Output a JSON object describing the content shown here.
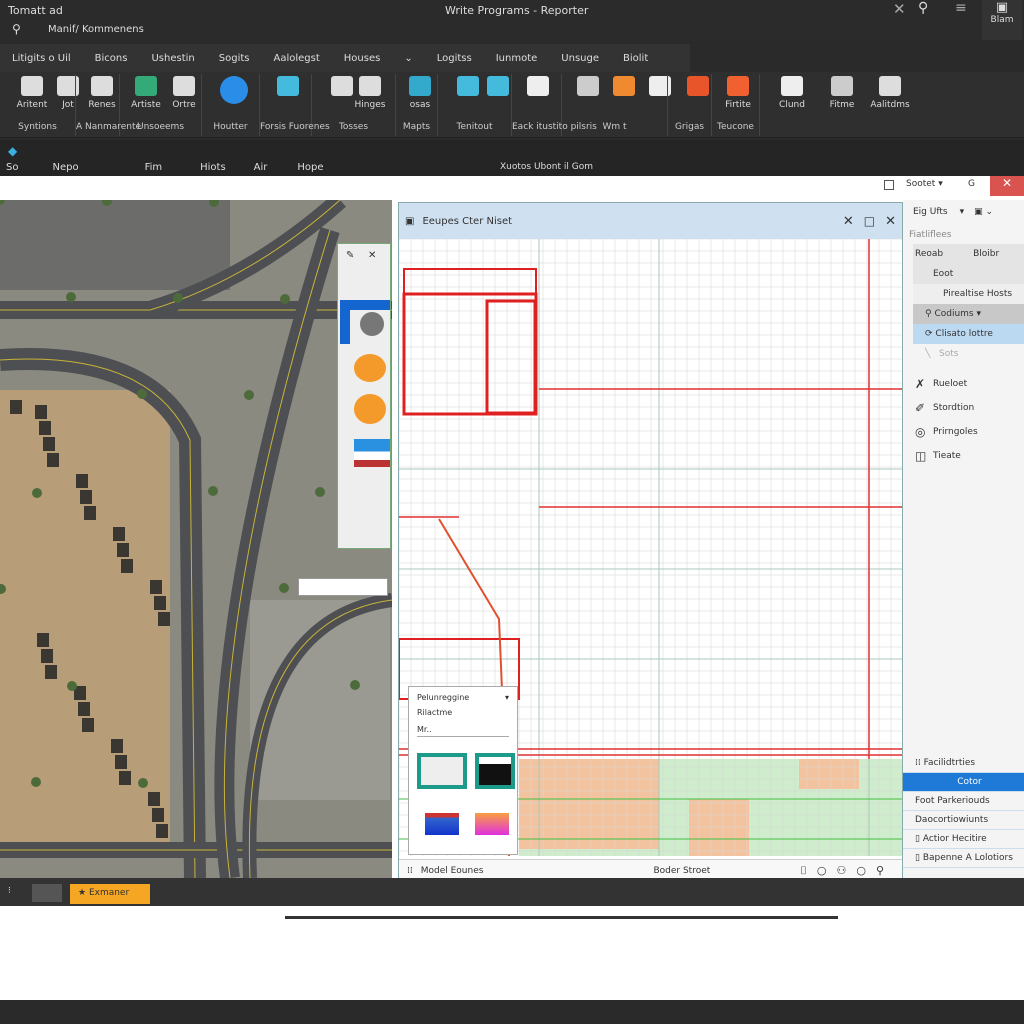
{
  "window": {
    "left_title": "Tomatt ad",
    "center_title": "Write Programs - Reporter",
    "subtitle": "Manif/ Kommenens",
    "blam_label": "Blam"
  },
  "menu": [
    "Litigits o Uil",
    "Bicons",
    "Ushestin",
    "Sogits",
    "Aalolegst",
    "Houses",
    "Logitss",
    "Iunmote",
    "Unsuge",
    "Biolit"
  ],
  "ribbon": {
    "buttons": [
      {
        "label": "Aritent",
        "icon": "map-layer-icon",
        "color": "#ddd"
      },
      {
        "label": "Jot",
        "icon": "pen-icon",
        "color": "#ddd"
      },
      {
        "label": "Renes",
        "icon": "table-icon",
        "color": "#ddd"
      },
      {
        "label": "Artiste",
        "icon": "globe-icon",
        "color": "#3a7"
      },
      {
        "label": "Ortre",
        "icon": "bucket-icon",
        "color": "#ddd"
      },
      {
        "label": "",
        "icon": "record-icon",
        "color": "#2a8ee8"
      },
      {
        "label": "",
        "icon": "printer-icon",
        "color": "#4bd"
      },
      {
        "label": "",
        "icon": "line-icon",
        "color": "#ddd"
      },
      {
        "label": "Hinges",
        "icon": "image-icon",
        "color": "#ddd"
      },
      {
        "label": "osas",
        "icon": "info-icon",
        "color": "#3ac"
      },
      {
        "label": "",
        "icon": "hook-icon",
        "color": "#4bd"
      },
      {
        "label": "",
        "icon": "printer-icon",
        "color": "#4bd"
      },
      {
        "label": "",
        "icon": "document-icon",
        "color": "#eee"
      },
      {
        "label": "",
        "icon": "face-icon",
        "color": "#ccc"
      },
      {
        "label": "",
        "icon": "swirl-icon",
        "color": "#f08a30"
      },
      {
        "label": "",
        "icon": "brush-icon",
        "color": "#eee"
      },
      {
        "label": "",
        "icon": "shape-icon",
        "color": "#e8552a"
      },
      {
        "label": "Firtite",
        "icon": "fire-icon",
        "color": "#f06030"
      },
      {
        "label": "Clund",
        "icon": "cloud-icon",
        "color": "#eee"
      },
      {
        "label": "Fitme",
        "icon": "list-icon",
        "color": "#ccc"
      },
      {
        "label": "Aalitdms",
        "icon": "frame-icon",
        "color": "#ddd"
      }
    ],
    "groups": [
      "Syntions",
      "A Nanmarente",
      "Unsoeems",
      "Houtter",
      "Forsis Fuorenes",
      "Tosses",
      "Mapts",
      "Tenitout",
      "Eack itustito pilsris",
      "Wm t",
      "Grigas",
      "Teucone"
    ]
  },
  "subbar": {
    "items": [
      "So",
      "Nepo",
      "Fim",
      "Hiots",
      "Air",
      "Hope"
    ],
    "center": "Xuotos Ubont il Gom"
  },
  "header_right": {
    "dropdown": "Sootet",
    "g": "G"
  },
  "plan_window": {
    "title": "Eeupes Cter Niset",
    "status_left": "Model Eounes",
    "status_center": "Boder Stroet"
  },
  "legend": {
    "title": "Pelunreggine",
    "subtitle": "Rilactme",
    "field": "Mr.."
  },
  "right_panel": {
    "top": "Eig Ufts",
    "section": "Fiatliflees",
    "rows": [
      "Reoab",
      "Bloibr",
      "Eoot",
      "Pirealtise Hosts"
    ],
    "selected": "Codiums",
    "highlight": "Clisato lottre",
    "faded": "Sots",
    "tools": [
      {
        "label": "Rueloet",
        "icon": "wrench-icon"
      },
      {
        "label": "Stordtion",
        "icon": "pin-icon"
      },
      {
        "label": "Prirngoles",
        "icon": "location-icon"
      },
      {
        "label": "Tieate",
        "icon": "layout-icon"
      }
    ],
    "bottom": [
      "Facilidtrties",
      "Cotor",
      "Foot Parkeriouds",
      "Daocortiowiunts",
      "Actior Hecitire",
      "Bapenne A Lolotiors"
    ]
  },
  "bottom_bar": {
    "tab": "Exmaner"
  },
  "colors": {
    "accent": "#1e7ad6",
    "tab": "#f5a623",
    "close": "#d9534f"
  }
}
